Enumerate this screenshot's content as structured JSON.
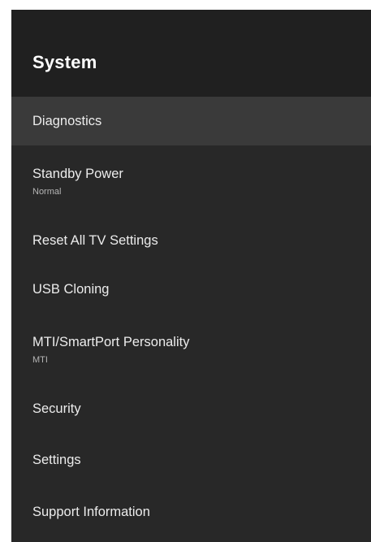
{
  "header": {
    "title": "System"
  },
  "menu": {
    "items": [
      {
        "label": "Diagnostics"
      },
      {
        "label": "Standby Power",
        "value": "Normal"
      },
      {
        "label": "Reset All TV Settings"
      },
      {
        "label": "USB Cloning"
      },
      {
        "label": "MTI/SmartPort Personality",
        "value": "MTI"
      },
      {
        "label": "Security"
      },
      {
        "label": "Settings"
      },
      {
        "label": "Support Information"
      }
    ],
    "selected": "Diagnostics"
  },
  "colors": {
    "panel": "#282828",
    "header": "#202020",
    "selected_row": "#3a3a3a",
    "text": "#ececec",
    "subtext": "#b5b5b5"
  }
}
